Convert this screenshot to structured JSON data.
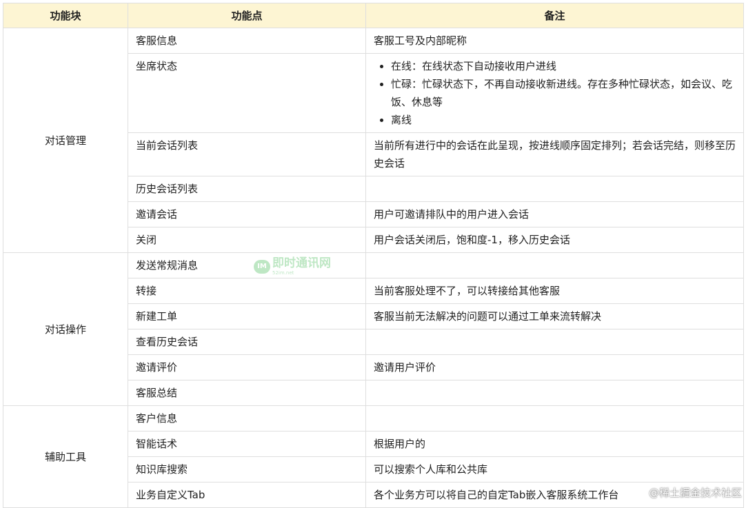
{
  "headers": {
    "block": "功能块",
    "point": "功能点",
    "note": "备注"
  },
  "groups": [
    {
      "name": "对话管理",
      "rows": [
        {
          "point": "客服信息",
          "note": "客服工号及内部昵称"
        },
        {
          "point": "坐席状态",
          "note_list": [
            "在线：在线状态下自动接收用户进线",
            "忙碌：忙碌状态下，不再自动接收新进线。存在多种忙碌状态，如会议、吃饭、休息等",
            "离线"
          ]
        },
        {
          "point": "当前会话列表",
          "note": "当前所有进行中的会话在此呈现，按进线顺序固定排列；若会话完结，则移至历史会话"
        },
        {
          "point": "历史会话列表",
          "note": ""
        },
        {
          "point": "邀请会话",
          "note": "用户可邀请排队中的用户进入会话"
        },
        {
          "point": "关闭",
          "note": "用户会话关闭后，饱和度-1，移入历史会话"
        }
      ]
    },
    {
      "name": "对话操作",
      "rows": [
        {
          "point": "发送常规消息",
          "note": ""
        },
        {
          "point": "转接",
          "note": "当前客服处理不了，可以转接给其他客服"
        },
        {
          "point": "新建工单",
          "note": "客服当前无法解决的问题可以通过工单来流转解决"
        },
        {
          "point": "查看历史会话",
          "note": ""
        },
        {
          "point": "邀请评价",
          "note": "邀请用户评价"
        },
        {
          "point": "客服总结",
          "note": ""
        }
      ]
    },
    {
      "name": "辅助工具",
      "rows": [
        {
          "point": "客户信息",
          "note": ""
        },
        {
          "point": "智能话术",
          "note": "根据用户的"
        },
        {
          "point": "知识库搜索",
          "note": "可以搜索个人库和公共库"
        },
        {
          "point": "业务自定义Tab",
          "note": "各个业务方可以将自己的自定Tab嵌入客服系统工作台"
        }
      ]
    }
  ],
  "watermarks": {
    "logo_badge": "IM",
    "logo_text": "即时通讯网",
    "logo_subtext": "52im.net",
    "corner": "@稀土掘金技术社区"
  },
  "colors": {
    "header_bg": "#fdf5d3",
    "border": "#dedede",
    "logo_green": "#39b54a"
  }
}
